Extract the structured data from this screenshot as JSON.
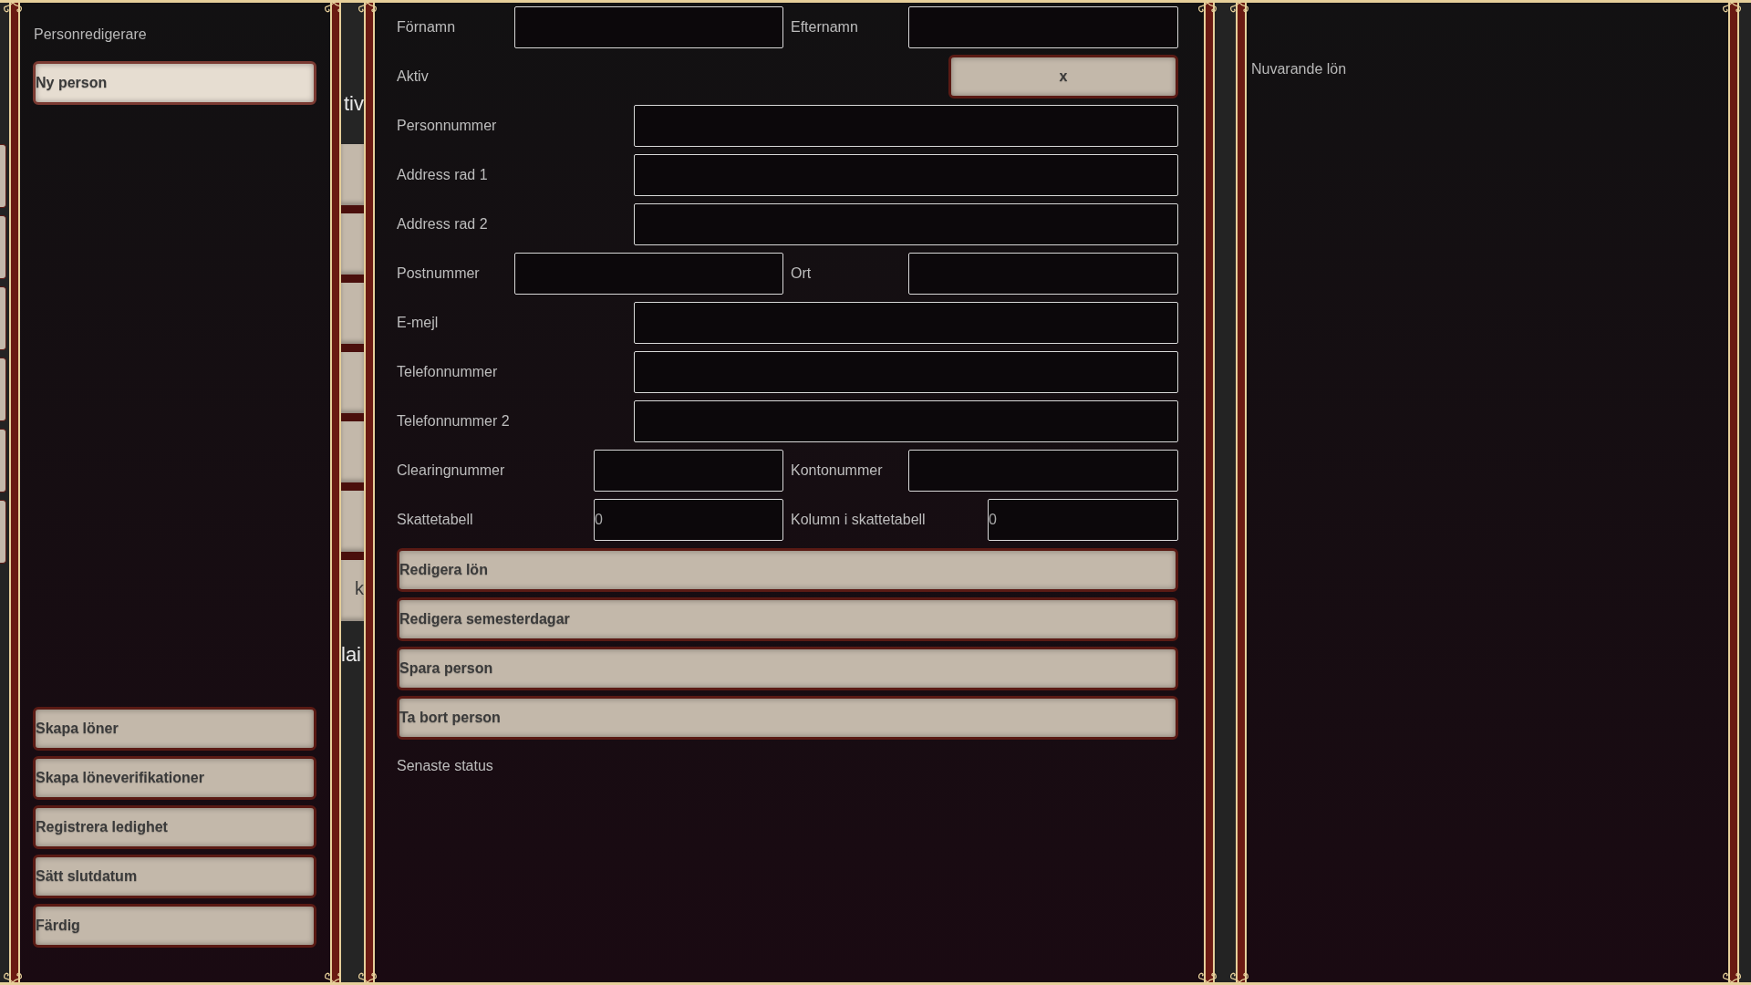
{
  "left_panel": {
    "title": "Personredigerare",
    "persons": [
      {
        "label": "Ny person",
        "selected": true
      }
    ],
    "actions": [
      "Skapa löner",
      "Skapa löneverifikationer",
      "Registrera ledighet",
      "Sätt slutdatum",
      "Färdig"
    ]
  },
  "background_window": {
    "fragments": [
      "tiv",
      "k",
      "lai"
    ]
  },
  "form": {
    "rows": [
      {
        "kind": "pair",
        "fields": [
          {
            "label": "Förnamn"
          },
          {
            "label": "Efternamn"
          }
        ]
      },
      {
        "kind": "toggle",
        "label": "Aktiv",
        "button": "x"
      },
      {
        "kind": "single",
        "label": "Personnummer"
      },
      {
        "kind": "single",
        "label": "Address rad 1"
      },
      {
        "kind": "single",
        "label": "Address rad 2"
      },
      {
        "kind": "pair",
        "fields": [
          {
            "label": "Postnummer"
          },
          {
            "label": "Ort"
          }
        ]
      },
      {
        "kind": "single",
        "label": "E-mejl"
      },
      {
        "kind": "single",
        "label": "Telefonnummer"
      },
      {
        "kind": "single",
        "label": "Telefonnummer 2"
      },
      {
        "kind": "pair",
        "fields": [
          {
            "label": "Clearingnummer"
          },
          {
            "label": "Kontonummer"
          }
        ]
      },
      {
        "kind": "pair",
        "fields": [
          {
            "label": "Skattetabell",
            "value": "0"
          },
          {
            "label": "Kolumn i skattetabell",
            "value": "0"
          }
        ]
      },
      {
        "kind": "button",
        "label": "Redigera lön"
      },
      {
        "kind": "button",
        "label": "Redigera semesterdagar"
      },
      {
        "kind": "button",
        "label": "Spara person"
      },
      {
        "kind": "button",
        "label": "Ta bort person"
      },
      {
        "kind": "text",
        "label": "Senaste status"
      }
    ]
  },
  "right_panel": {
    "title": "Nuvarande lön"
  }
}
